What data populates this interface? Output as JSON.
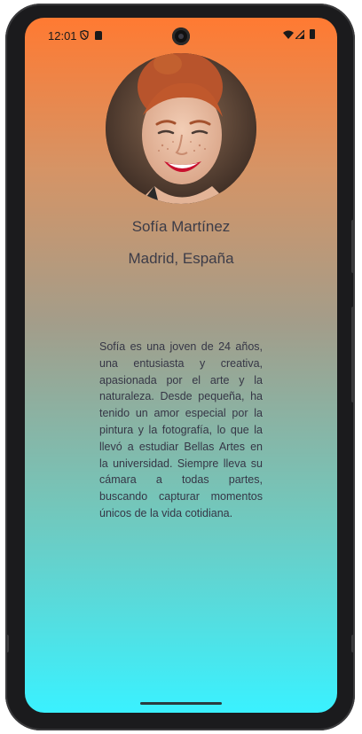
{
  "status_bar": {
    "time": "12:01",
    "icons": [
      "shield-icon",
      "sd-card-icon",
      "wifi-icon",
      "signal-icon",
      "battery-icon"
    ]
  },
  "profile": {
    "name": "Sofía Martínez",
    "location": "Madrid, España",
    "bio": "Sofía es una joven de 24 años, una entusiasta y creativa, apasionada por el arte y la naturaleza. Desde pequeña, ha tenido un amor especial por la pintura y la fotografía, lo que la llevó a estudiar Bellas Artes en la universidad. Siempre lleva su cámara a todas partes, buscando capturar momentos únicos de la vida cotidiana."
  },
  "colors": {
    "gradient_top": "#ff7a32",
    "gradient_bottom": "#3af1ff",
    "text": "#3c3c48"
  }
}
